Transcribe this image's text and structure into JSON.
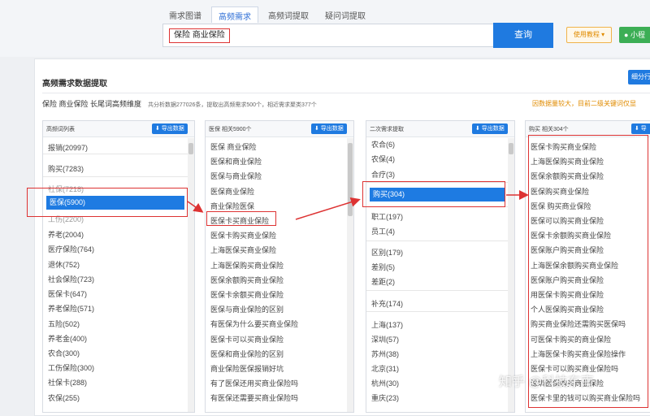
{
  "tabs": [
    "需求图谱",
    "高频需求",
    "高频词提取",
    "疑问词提取"
  ],
  "search": {
    "value": "保险 商业保险",
    "button": "查询"
  },
  "help_button": "使用教程 ▾",
  "mini_button": "小程",
  "card": {
    "title": "高频需求数据提取",
    "right_button": "细分行"
  },
  "subline": {
    "keyword": "保险 商业保险 长尾词高频维度",
    "stats": "共分析数据277026条，提取出高频需求500个，相近需求聚类377个"
  },
  "note": "因数据量较大，目前二级关键词仅显",
  "export_label": "⬇ 导出数据",
  "columns": [
    {
      "header": "高频词列表",
      "items": [
        "报销(20997)",
        "购买(7283)",
        "社保(7218)",
        "医保(5900)",
        "工伤(2200)",
        "养老(2004)",
        "医疗保险(764)",
        "退休(752)",
        "社会保险(723)",
        "医保卡(647)",
        "养老保险(571)",
        "五险(502)",
        "养老金(400)",
        "农合(300)",
        "工伤保险(300)",
        "社保卡(288)",
        "农保(255)"
      ]
    },
    {
      "header": "医保 相关5900个",
      "items": [
        "医保 商业保险",
        "医保和商业保险",
        "医保与商业保险",
        "医保商业保险",
        "商业保险医保",
        "医保卡买商业保险",
        "医保卡购买商业保险",
        "上海医保买商业保险",
        "上海医保购买商业保险",
        "医保余额购买商业保险",
        "医保卡余额买商业保险",
        "医保与商业保险的区别",
        "有医保为什么要买商业保险",
        "医保卡可以买商业保险",
        "医保和商业保险的区别",
        "商业保险医保报销好坑",
        "有了医保还用买商业保险吗",
        "有医保还需要买商业保险吗"
      ]
    },
    {
      "header": "二次需求提取",
      "items": [
        "农合(6)",
        "农保(4)",
        "合疗(3)",
        "购买(304)",
        "职工(197)",
        "员工(4)",
        "区别(179)",
        "差别(5)",
        "差距(2)",
        "补充(174)",
        "上海(137)",
        "深圳(57)",
        "苏州(38)",
        "北京(31)",
        "杭州(30)",
        "重庆(23)"
      ]
    },
    {
      "header": "购买 相关304个",
      "items": [
        "医保卡购买商业保险",
        "上海医保购买商业保险",
        "医保余额购买商业保险",
        "医保购买商业保险",
        "医保 购买商业保险",
        "医保可以购买商业保险",
        "医保卡余额购买商业保险",
        "医保账户购买商业保险",
        "上海医保余额购买商业保险",
        "医保账户购买商业保险",
        "用医保卡购买商业保险",
        "个人医保购买商业保险",
        "购买商业保险还需购买医保吗",
        "可医保卡购买的商业保险",
        "上海医保卡购买商业保险操作",
        "医保卡可以购买商业保险吗",
        "深圳医保购买商业保险",
        "医保卡里的钱可以购买商业保险吗"
      ]
    }
  ],
  "watermark": "知乎 @科技东南"
}
